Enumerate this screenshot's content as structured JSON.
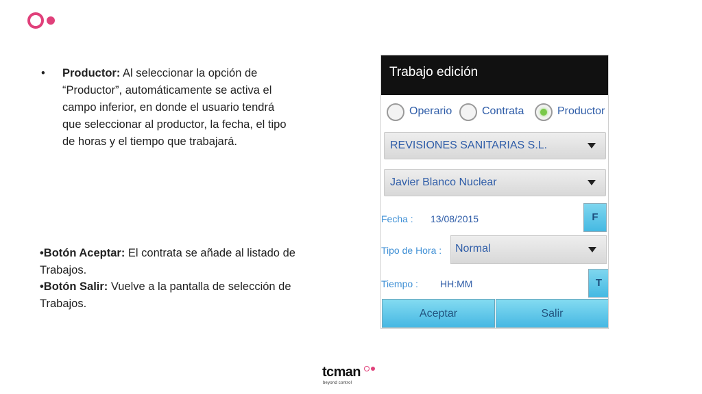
{
  "slide": {
    "bullet_symbol": "•",
    "productor_heading": "Productor:",
    "productor_text": " Al seleccionar la opción de “Productor”, automáticamente se activa el campo inferior, en donde el usuario tendrá que seleccionar al productor, la fecha, el tipo de horas y el tiempo que trabajará.",
    "aceptar_heading": "•Botón Aceptar:",
    "aceptar_text": " El contrata se añade al listado de Trabajos.",
    "salir_heading": "•Botón Salir:",
    "salir_text": " Vuelve a la pantalla de selección de Trabajos."
  },
  "app": {
    "title": "Trabajo edición",
    "radio_options": [
      {
        "label": "Operario",
        "selected": false
      },
      {
        "label": "Contrata",
        "selected": false
      },
      {
        "label": "Productor",
        "selected": true
      }
    ],
    "company_select": "REVISIONES SANITARIAS S.L.",
    "producer_select": "Javier Blanco Nuclear",
    "fecha_label": "Fecha :",
    "fecha_value": "13/08/2015",
    "fecha_button": "F",
    "tipo_hora_label": "Tipo de Hora :",
    "tipo_hora_value": "Normal",
    "tiempo_label": "Tiempo :",
    "tiempo_value": "HH:MM",
    "tiempo_button": "T",
    "aceptar_button": "Aceptar",
    "salir_button": "Salir"
  },
  "brand": {
    "name": "tcman",
    "tagline": "beyond control"
  },
  "colors": {
    "accent_pink": "#e0407a",
    "phone_header": "#111111",
    "android_blue": "#2f5da8",
    "button_cyan": "#47b8e3",
    "radio_green": "#79c84a"
  },
  "icons": {
    "logo": "ring-dot-logo",
    "dropdown": "triangle-down-icon",
    "radio": "radio-button-icon"
  }
}
